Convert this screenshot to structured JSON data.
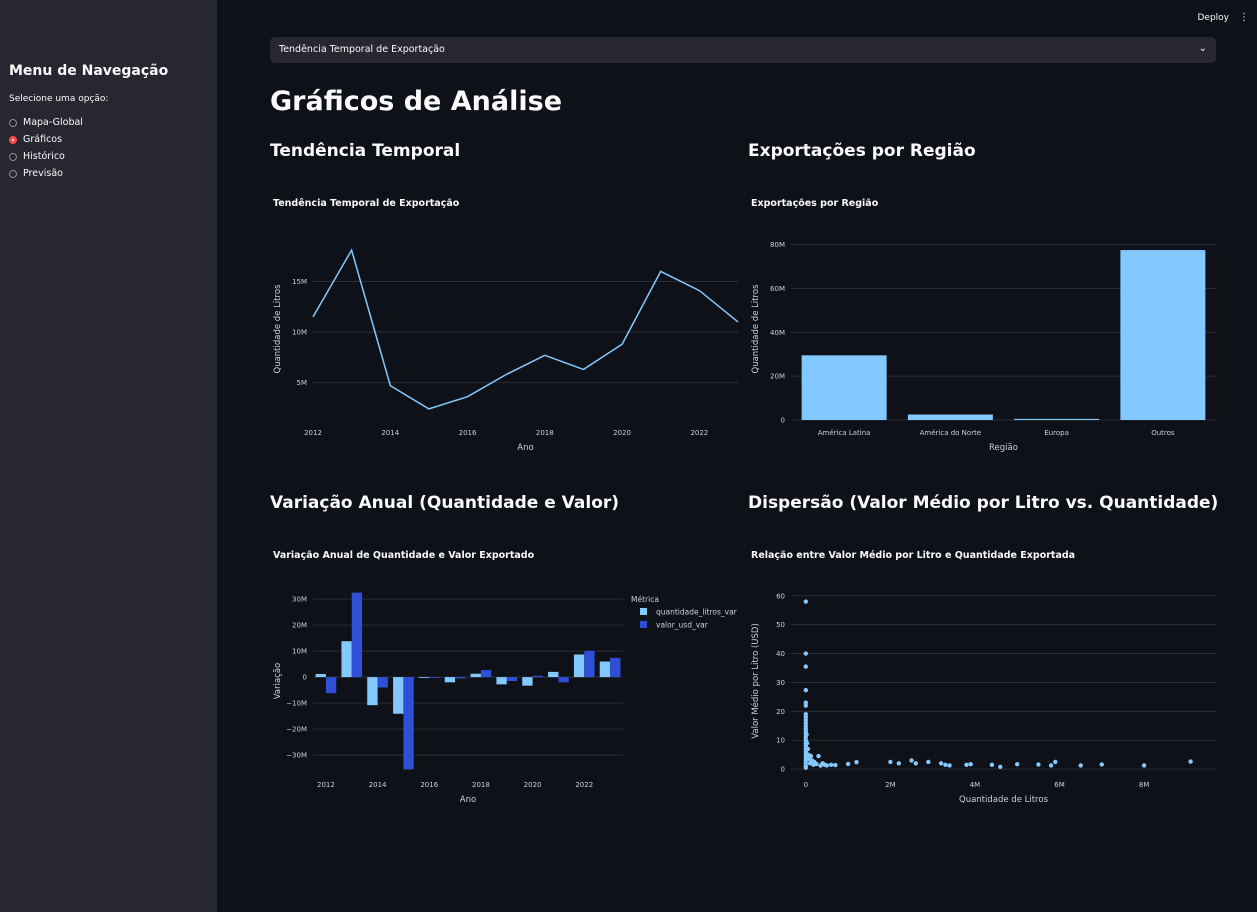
{
  "sidebar": {
    "title": "Menu de Navegação",
    "subtitle": "Selecione uma opção:",
    "options": [
      {
        "label": "Mapa-Global",
        "selected": false
      },
      {
        "label": "Gráficos",
        "selected": true
      },
      {
        "label": "Histórico",
        "selected": false
      },
      {
        "label": "Previsão",
        "selected": false
      }
    ]
  },
  "toolbar": {
    "deploy_label": "Deploy",
    "menu_icon": "kebab-menu-icon"
  },
  "selectbox": {
    "value": "Tendência Temporal de Exportação",
    "icon": "chevron-down-icon"
  },
  "page": {
    "title": "Gráficos de Análise",
    "sections": {
      "trend": "Tendência Temporal",
      "region": "Exportações por Região",
      "variation": "Variação Anual (Quantidade e Valor)",
      "scatter": "Dispersão (Valor Médio por Litro vs. Quantidade)"
    }
  },
  "colors": {
    "light_blue": "#83c9ff",
    "dark_blue": "#2e4fd6",
    "accent_red": "#ff4b4b",
    "grid": "#2b2e36"
  },
  "chart_data": [
    {
      "id": "trend",
      "type": "line",
      "title": "Tendência Temporal de Exportação",
      "xlabel": "Ano",
      "ylabel": "Quantidade de Litros",
      "x": [
        2012,
        2013,
        2014,
        2015,
        2016,
        2017,
        2018,
        2019,
        2020,
        2021,
        2022,
        2023
      ],
      "values": [
        11500000,
        18100000,
        4700000,
        2400000,
        3600000,
        5800000,
        7700000,
        6300000,
        8800000,
        16000000,
        14100000,
        11000000
      ],
      "xlim": [
        2012,
        2023
      ],
      "ylim": [
        1300000,
        19300000
      ],
      "xticks": [
        2012,
        2014,
        2016,
        2018,
        2020,
        2022
      ],
      "xtick_labels": [
        "2012",
        "2014",
        "2016",
        "2018",
        "2020",
        "2022"
      ],
      "yticks": [
        5000000,
        10000000,
        15000000
      ],
      "ytick_labels": [
        "5M",
        "10M",
        "15M"
      ],
      "grid": true
    },
    {
      "id": "region",
      "type": "bar",
      "title": "Exportações por Região",
      "xlabel": "Região",
      "ylabel": "Quantidade de Litros",
      "categories": [
        "América Latina",
        "América do Norte",
        "Europa",
        "Outros"
      ],
      "values": [
        29500000,
        2500000,
        500000,
        77500000
      ],
      "ylim": [
        0,
        83000000
      ],
      "yticks": [
        0,
        20000000,
        40000000,
        60000000,
        80000000
      ],
      "ytick_labels": [
        "0",
        "20M",
        "40M",
        "60M",
        "80M"
      ],
      "grid": true
    },
    {
      "id": "variation",
      "type": "bar",
      "title": "Variação Anual de Quantidade e Valor Exportado",
      "xlabel": "Ano",
      "ylabel": "Variação",
      "legend_title": "Métrica",
      "legend_position": "right",
      "x": [
        2012,
        2013,
        2014,
        2015,
        2016,
        2017,
        2018,
        2019,
        2020,
        2021,
        2022,
        2023
      ],
      "series": [
        {
          "name": "quantidade_litros_var",
          "values": [
            1200000,
            13800000,
            -10800000,
            -14100000,
            -300000,
            -2000000,
            1300000,
            -2800000,
            -3300000,
            2000000,
            8700000,
            6000000
          ]
        },
        {
          "name": "valor_usd_var",
          "values": [
            -6200000,
            32500000,
            -4000000,
            -35500000,
            -300000,
            -500000,
            2700000,
            -1500000,
            500000,
            -2000000,
            10100000,
            7400000
          ]
        }
      ],
      "xlim": [
        2011.5,
        2023.5
      ],
      "ylim": [
        -36500000,
        33500000
      ],
      "xticks": [
        2012,
        2014,
        2016,
        2018,
        2020,
        2022
      ],
      "xtick_labels": [
        "2012",
        "2014",
        "2016",
        "2018",
        "2020",
        "2022"
      ],
      "yticks": [
        -30000000,
        -20000000,
        -10000000,
        0,
        10000000,
        20000000,
        30000000
      ],
      "ytick_labels": [
        "−30M",
        "−20M",
        "−10M",
        "0",
        "10M",
        "20M",
        "30M"
      ],
      "grid": true
    },
    {
      "id": "scatter",
      "type": "scatter",
      "title": "Relação entre Valor Médio por Litro e Quantidade Exportada",
      "xlabel": "Quantidade de Litros",
      "ylabel": "Valor Médio por Litro (USD)",
      "points": [
        [
          0,
          58
        ],
        [
          0,
          40
        ],
        [
          0,
          35.5
        ],
        [
          0,
          27.3
        ],
        [
          0,
          23
        ],
        [
          0,
          22
        ],
        [
          0,
          19
        ],
        [
          0,
          18
        ],
        [
          0,
          17
        ],
        [
          0,
          16
        ],
        [
          0,
          15
        ],
        [
          0,
          14
        ],
        [
          0,
          13
        ],
        [
          0,
          12
        ],
        [
          0,
          11
        ],
        [
          0,
          10
        ],
        [
          0,
          9
        ],
        [
          0,
          8
        ],
        [
          0,
          7
        ],
        [
          0,
          6
        ],
        [
          0,
          5
        ],
        [
          0,
          4
        ],
        [
          0,
          3
        ],
        [
          0,
          2
        ],
        [
          0,
          1
        ],
        [
          0,
          0.5
        ],
        [
          20000,
          12
        ],
        [
          30000,
          9
        ],
        [
          50000,
          7
        ],
        [
          60000,
          5
        ],
        [
          80000,
          3.5
        ],
        [
          100000,
          2
        ],
        [
          120000,
          4.5
        ],
        [
          150000,
          3
        ],
        [
          180000,
          1.5
        ],
        [
          200000,
          2.5
        ],
        [
          250000,
          1.8
        ],
        [
          300000,
          4.5
        ],
        [
          350000,
          1.2
        ],
        [
          400000,
          2
        ],
        [
          450000,
          1.5
        ],
        [
          500000,
          1.3
        ],
        [
          600000,
          1.5
        ],
        [
          700000,
          1.4
        ],
        [
          1000000,
          1.8
        ],
        [
          1200000,
          2.4
        ],
        [
          2000000,
          2.5
        ],
        [
          2200000,
          2.0
        ],
        [
          2500000,
          3.0
        ],
        [
          2600000,
          2.0
        ],
        [
          2900000,
          2.5
        ],
        [
          3200000,
          2.0
        ],
        [
          3300000,
          1.5
        ],
        [
          3400000,
          1.3
        ],
        [
          3800000,
          1.5
        ],
        [
          3900000,
          1.7
        ],
        [
          4400000,
          1.5
        ],
        [
          4600000,
          0.8
        ],
        [
          5000000,
          1.7
        ],
        [
          5500000,
          1.6
        ],
        [
          5800000,
          1.3
        ],
        [
          5900000,
          2.5
        ],
        [
          6500000,
          1.3
        ],
        [
          7000000,
          1.6
        ],
        [
          8000000,
          1.3
        ],
        [
          9100000,
          2.6
        ]
      ],
      "xlim": [
        -350000,
        9700000
      ],
      "ylim": [
        -1,
        62
      ],
      "xticks": [
        0,
        2000000,
        4000000,
        6000000,
        8000000
      ],
      "xtick_labels": [
        "0",
        "2M",
        "4M",
        "6M",
        "8M"
      ],
      "yticks": [
        0,
        10,
        20,
        30,
        40,
        50,
        60
      ],
      "ytick_labels": [
        "0",
        "10",
        "20",
        "30",
        "40",
        "50",
        "60"
      ],
      "grid": true
    }
  ]
}
